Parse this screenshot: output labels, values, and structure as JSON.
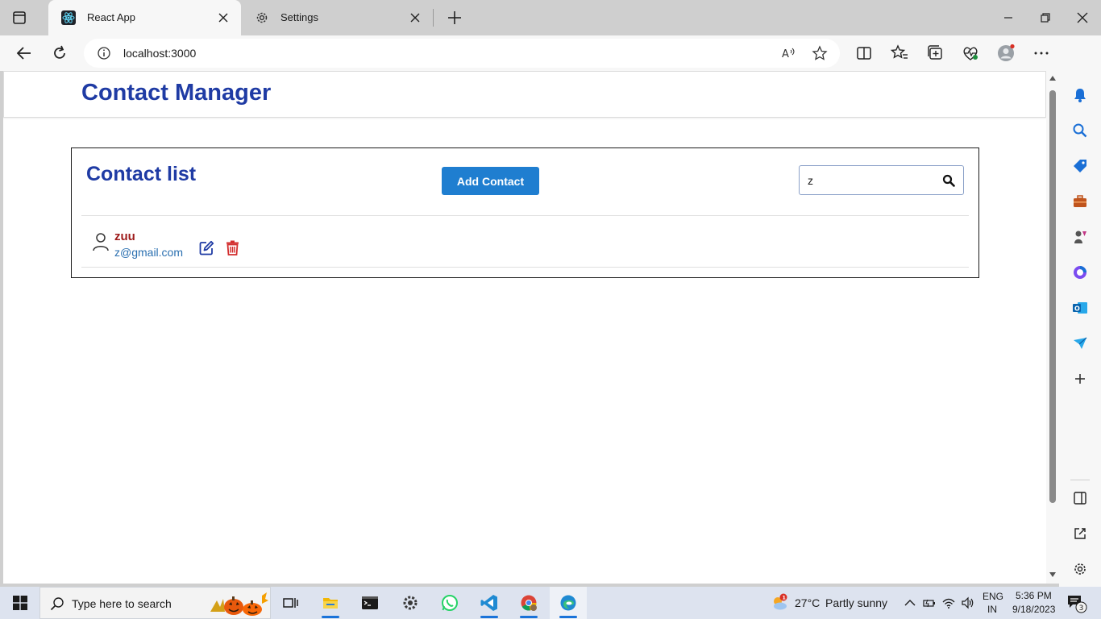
{
  "browser": {
    "tabs": [
      {
        "title": "React App",
        "active": true
      },
      {
        "title": "Settings",
        "active": false
      }
    ],
    "address": {
      "url": "localhost:3000"
    }
  },
  "app": {
    "header_title": "Contact Manager",
    "list_title": "Contact list",
    "add_button_label": "Add Contact",
    "search": {
      "value": "z",
      "placeholder": ""
    },
    "contacts": [
      {
        "name": "zuu",
        "email": "z@gmail.com"
      }
    ]
  },
  "taskbar": {
    "search_placeholder": "Type here to search",
    "weather": {
      "temp": "27°C",
      "condition": "Partly sunny",
      "badge": "1"
    },
    "language": {
      "lang": "ENG",
      "region": "IN"
    },
    "clock": {
      "time": "5:36 PM",
      "date": "9/18/2023"
    },
    "notifications_count": "3"
  },
  "colors": {
    "accent_blue": "#1f3ba4",
    "button_blue": "#1f7ed0",
    "name_red": "#9e1b1b",
    "email_blue": "#2a6fb0",
    "delete_red": "#d32f2f"
  },
  "icons": {
    "tab_actions": "tab-actions-icon",
    "react_favicon": "react-icon",
    "settings_favicon": "gear-icon",
    "back": "back-arrow-icon",
    "refresh": "refresh-icon",
    "info": "info-icon",
    "read_aloud": "read-aloud-icon",
    "favorite": "star-icon",
    "split": "split-screen-icon",
    "favorites": "favorites-icon",
    "collections": "collections-icon",
    "performance": "heart-pulse-icon",
    "profile": "profile-icon",
    "more": "more-icon",
    "copilot": "bing-icon",
    "avatar": "user-icon",
    "edit": "edit-icon",
    "delete": "trash-icon",
    "search": "search-icon"
  }
}
